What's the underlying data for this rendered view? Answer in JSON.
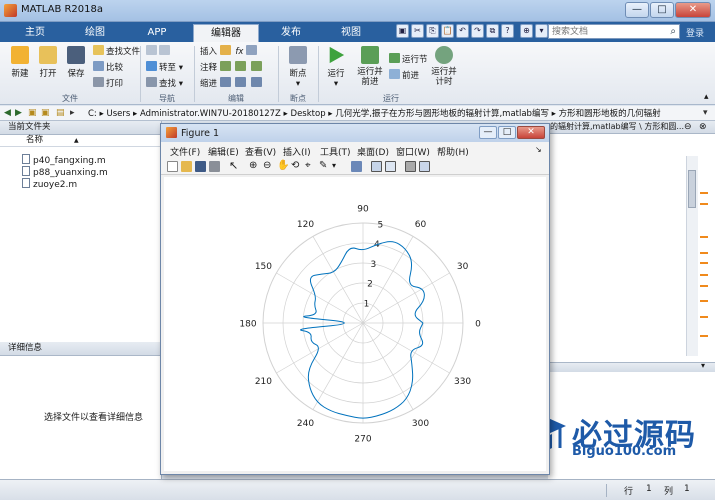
{
  "window": {
    "title": "MATLAB R2018a",
    "minimize": "—",
    "maximize": "□",
    "close": "✕"
  },
  "tabs": [
    "主页",
    "绘图",
    "APP",
    "编辑器",
    "发布",
    "视图"
  ],
  "search": {
    "placeholder": "搜索文档",
    "collapse": "登录"
  },
  "ribbon": {
    "file": {
      "new": "新建",
      "open": "打开",
      "save": "保存",
      "find_files": "查找文件",
      "compare": "比较",
      "print": "打印",
      "label": "文件"
    },
    "nav": {
      "goto": "转至",
      "find": "查找",
      "label": "导航"
    },
    "edit": {
      "insert": "插入",
      "comment": "注释",
      "indent": "缩进",
      "fx": "fx",
      "label": "编辑"
    },
    "breakpoints": {
      "breakpoints": "断点",
      "label": "断点"
    },
    "run": {
      "run": "运行",
      "run_advance": "运行并\n前进",
      "run_section": "运行节",
      "advance": "前进",
      "run_time": "运行并\n计时",
      "label": "运行"
    }
  },
  "address": {
    "path": "C:  ▸  Users  ▸  Administrator.WIN7U-20180127Z  ▸  Desktop  ▸  几何光学,振子在方形与圆形地板的辐射计算,matlab编写  ▸  方形和圆形地板的几何辐射"
  },
  "file_pane": {
    "title": "当前文件夹",
    "column": "名称",
    "sort_arrow": "▲",
    "files": [
      "p40_fangxing.m",
      "p88_yuanxing.m",
      "zuoye2.m"
    ]
  },
  "detail_pane": {
    "title": "详细信息",
    "message": "选择文件以查看详细信息"
  },
  "right_title": "的辐射计算,matlab编写 \\ 方形和圆...",
  "status": {
    "row_label": "行",
    "row": "1",
    "col_label": "列",
    "col": "1"
  },
  "figure": {
    "title": "Figure 1",
    "menu": [
      "文件(F)",
      "编辑(E)",
      "查看(V)",
      "插入(I)",
      "工具(T)",
      "桌面(D)",
      "窗口(W)",
      "帮助(H)"
    ]
  },
  "chart_data": {
    "type": "line",
    "projection": "polar",
    "theta_ticks_deg": [
      0,
      30,
      60,
      90,
      120,
      150,
      180,
      210,
      240,
      270,
      300,
      330
    ],
    "r_ticks": [
      1,
      2,
      3,
      4,
      5
    ],
    "rlim": [
      0,
      5
    ],
    "grid": true,
    "series": [
      {
        "color": "#0072bd",
        "theta_deg": [
          0,
          10,
          20,
          30,
          40,
          50,
          60,
          70,
          80,
          90,
          100,
          110,
          120,
          130,
          140,
          150,
          160,
          170,
          175,
          180,
          185,
          190,
          200,
          210,
          220,
          230,
          240,
          250,
          260,
          270,
          280,
          290,
          300,
          310,
          320,
          330,
          340,
          350,
          360
        ],
        "r": [
          3.0,
          2.5,
          3.3,
          3.5,
          2.9,
          3.9,
          4.3,
          4.4,
          4.0,
          3.6,
          3.9,
          3.2,
          2.9,
          3.2,
          3.6,
          2.7,
          2.6,
          2.3,
          3.4,
          0.1,
          3.5,
          2.6,
          2.8,
          2.4,
          3.6,
          4.2,
          4.6,
          4.7,
          4.7,
          4.8,
          4.7,
          4.6,
          4.4,
          3.9,
          3.2,
          2.7,
          3.3,
          2.8,
          3.0
        ]
      }
    ]
  },
  "watermark": {
    "title": "必过源码",
    "url": "Biguo100.com"
  },
  "colors": {
    "accent": "#29609f",
    "plot_line": "#0072bd"
  }
}
